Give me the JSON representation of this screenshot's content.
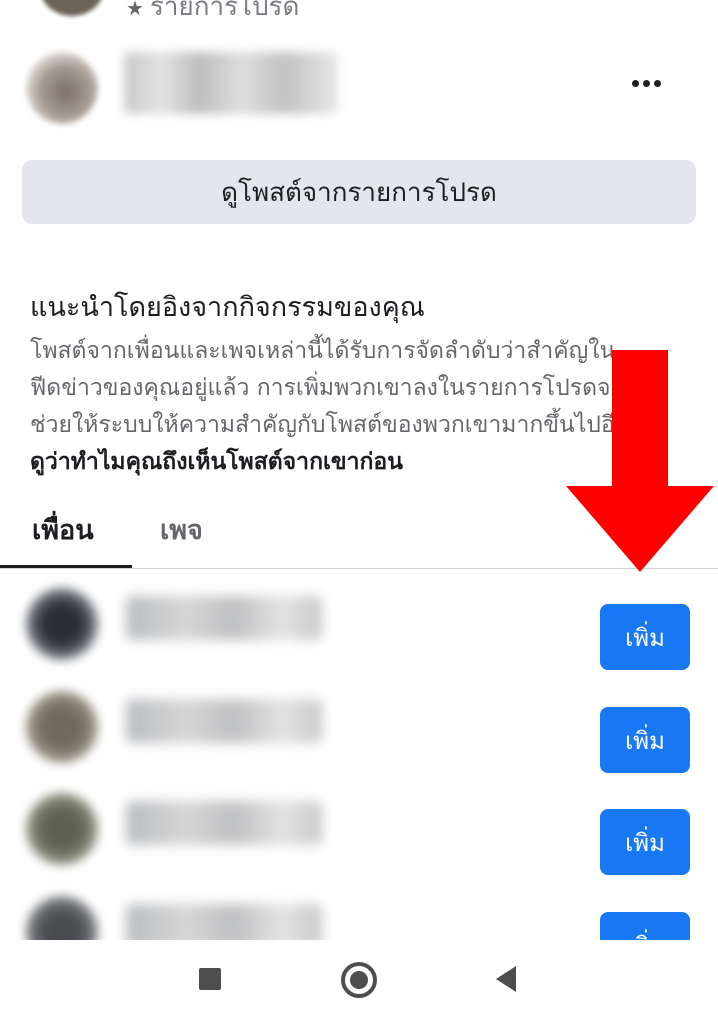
{
  "top": {
    "subtitle": "รายการโปรด",
    "subtitle_icon": "star-icon"
  },
  "profile": {
    "more_icon": "more-options-icon"
  },
  "see_posts_button": {
    "label": "ดูโพสต์จากรายการโปรด"
  },
  "suggestion": {
    "title": "แนะนำโดยอิงจากกิจกรรมของคุณ",
    "description": "โพสต์จากเพื่อนและเพจเหล่านี้ได้รับการจัดลำดับว่าสำคัญในฟีดข่าวของคุณอยู่แล้ว การเพิ่มพวกเขาลงในรายการโปรดจะช่วยให้ระบบให้ความสำคัญกับโพสต์ของพวกเขามากขึ้นไปอีก",
    "link_text": "ดูว่าทำไมคุณถึงเห็นโพสต์จากเขาก่อน"
  },
  "tabs": [
    {
      "label": "เพื่อน",
      "active": true
    },
    {
      "label": "เพจ",
      "active": false
    }
  ],
  "friends_list": [
    {
      "add_label": "เพิ่ม",
      "avatar_color": "#2a2e33"
    },
    {
      "add_label": "เพิ่ม",
      "avatar_color": "#6f6a5e"
    },
    {
      "add_label": "เพิ่ม",
      "avatar_color": "#5e6052"
    },
    {
      "add_label": "เพิ่ม",
      "avatar_color": "#4a4c50"
    }
  ],
  "colors": {
    "primary_button": "#1877f2",
    "secondary_button": "#e4e6eb",
    "annotation_arrow": "#ff0000",
    "nav_icons": "#4d4d4d"
  },
  "nav": {
    "icons": [
      "recent-apps-icon",
      "home-icon",
      "back-icon"
    ]
  }
}
